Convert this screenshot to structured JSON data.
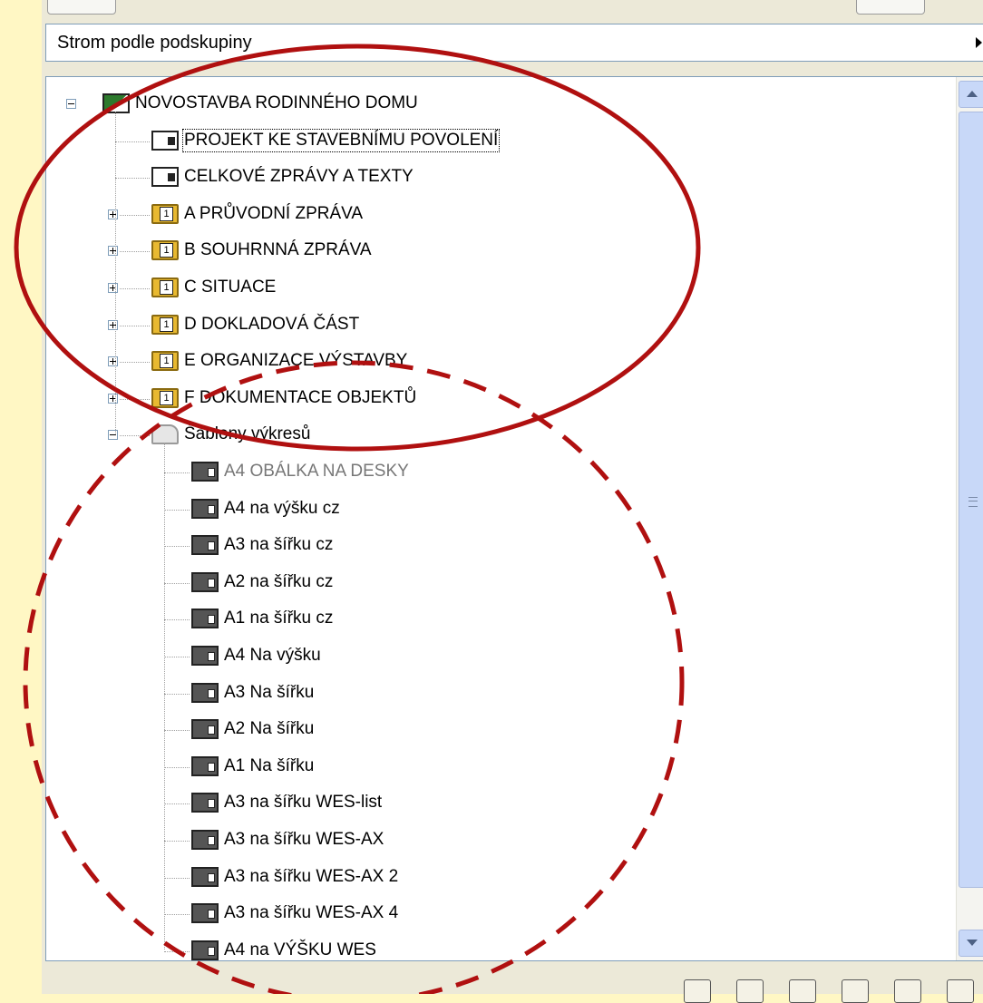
{
  "combo": {
    "value": "Strom podle podskupiny"
  },
  "tree": {
    "root": {
      "label": "NOVOSTAVBA RODINNÉHO DOMU",
      "expanded": true
    },
    "items": [
      {
        "label": "PROJEKT KE STAVEBNÍMU POVOLENÍ",
        "icon": "page-icon",
        "selected": true
      },
      {
        "label": "CELKOVÉ ZPRÁVY A TEXTY",
        "icon": "page-icon"
      },
      {
        "label": "A PRŮVODNÍ ZPRÁVA",
        "icon": "folder-icon",
        "expandable": true
      },
      {
        "label": "B SOUHRNNÁ ZPRÁVA",
        "icon": "folder-icon",
        "expandable": true
      },
      {
        "label": "C SITUACE",
        "icon": "folder-icon",
        "expandable": true
      },
      {
        "label": "D DOKLADOVÁ ČÁST",
        "icon": "folder-icon",
        "expandable": true
      },
      {
        "label": "E ORGANIZACE VÝSTAVBY",
        "icon": "folder-icon",
        "expandable": true
      },
      {
        "label": "F DOKUMENTACE OBJEKTŮ",
        "icon": "folder-icon",
        "expandable": true
      },
      {
        "label": "Šablony výkresů",
        "icon": "template-folder-icon",
        "expanded": true
      }
    ],
    "templates": [
      {
        "label": "A4  OBÁLKA NA DESKY",
        "dim": true
      },
      {
        "label": "A4 na výšku cz"
      },
      {
        "label": "A3 na šířku cz"
      },
      {
        "label": "A2 na šířku cz"
      },
      {
        "label": "A1 na šířku cz"
      },
      {
        "label": "A4 Na výšku"
      },
      {
        "label": "A3 Na šířku"
      },
      {
        "label": "A2 Na šířku"
      },
      {
        "label": "A1 Na šířku"
      },
      {
        "label": "A3 na šířku WES-list"
      },
      {
        "label": "A3 na šířku WES-AX"
      },
      {
        "label": "A3 na šířku WES-AX 2"
      },
      {
        "label": "A3 na šířku WES-AX 4"
      },
      {
        "label": "A4 na VÝŠKU WES"
      }
    ]
  },
  "toolbar": {
    "buttons": [
      "frame-icon",
      "new-page-icon",
      "new-template-icon",
      "new-folder-icon",
      "record-icon",
      "delete-icon"
    ]
  },
  "colors": {
    "background": "#fff7c4",
    "panel": "#ece9d8",
    "annotation": "#b01010"
  }
}
